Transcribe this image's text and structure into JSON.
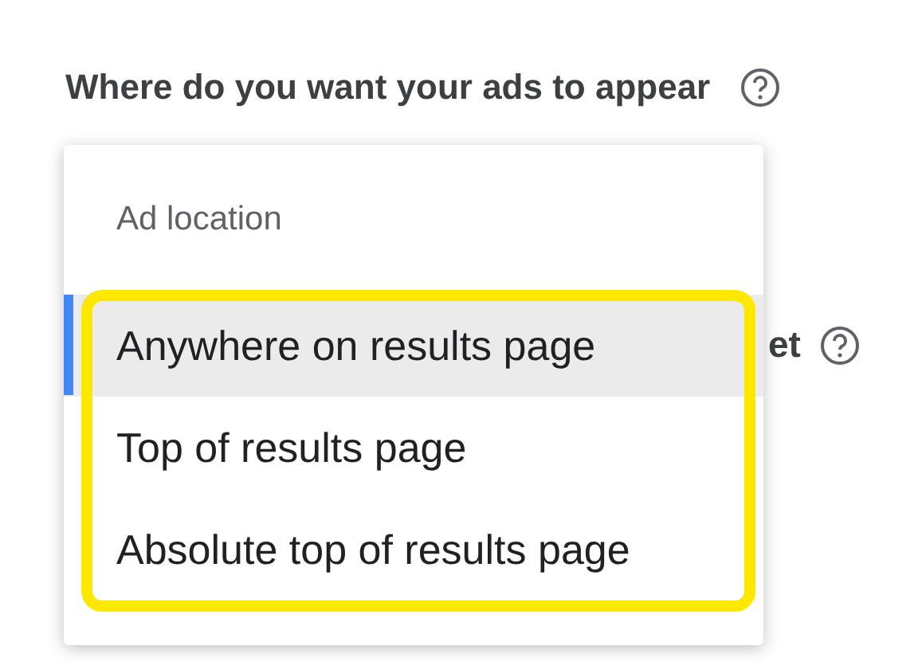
{
  "question": {
    "label": "Where do you want your ads to appear"
  },
  "behind_field": {
    "label_fragment": "et"
  },
  "menu": {
    "header": "Ad location",
    "options": [
      {
        "label": "Anywhere on results page",
        "selected": true
      },
      {
        "label": "Top of results page",
        "selected": false
      },
      {
        "label": "Absolute top of results page",
        "selected": false
      }
    ]
  }
}
